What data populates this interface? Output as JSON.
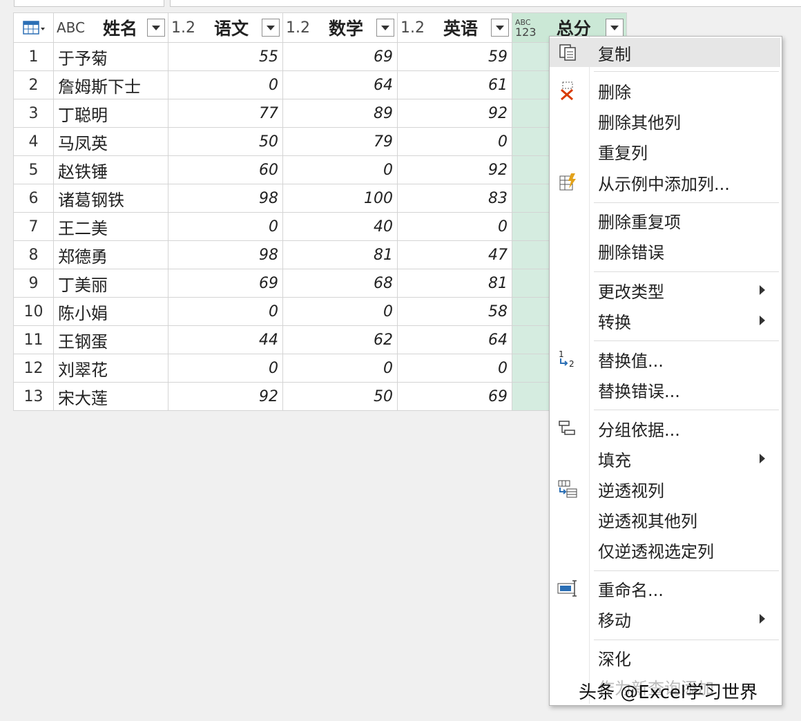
{
  "columns": [
    {
      "type": "ABC",
      "name": "姓名"
    },
    {
      "type": "1.2",
      "name": "语文"
    },
    {
      "type": "1.2",
      "name": "数学"
    },
    {
      "type": "1.2",
      "name": "英语"
    },
    {
      "type_top": "ABC",
      "type_bottom": "123",
      "name": "总分"
    }
  ],
  "rows": [
    {
      "n": "1",
      "name": "于予菊",
      "yw": "55",
      "sx": "69",
      "yy": "59"
    },
    {
      "n": "2",
      "name": "詹姆斯下士",
      "yw": "0",
      "sx": "64",
      "yy": "61"
    },
    {
      "n": "3",
      "name": "丁聪明",
      "yw": "77",
      "sx": "89",
      "yy": "92"
    },
    {
      "n": "4",
      "name": "马凤英",
      "yw": "50",
      "sx": "79",
      "yy": "0"
    },
    {
      "n": "5",
      "name": "赵铁锤",
      "yw": "60",
      "sx": "0",
      "yy": "92"
    },
    {
      "n": "6",
      "name": "诸葛钢铁",
      "yw": "98",
      "sx": "100",
      "yy": "83"
    },
    {
      "n": "7",
      "name": "王二美",
      "yw": "0",
      "sx": "40",
      "yy": "0"
    },
    {
      "n": "8",
      "name": "郑德勇",
      "yw": "98",
      "sx": "81",
      "yy": "47"
    },
    {
      "n": "9",
      "name": "丁美丽",
      "yw": "69",
      "sx": "68",
      "yy": "81"
    },
    {
      "n": "10",
      "name": "陈小娟",
      "yw": "0",
      "sx": "0",
      "yy": "58"
    },
    {
      "n": "11",
      "name": "王钢蛋",
      "yw": "44",
      "sx": "62",
      "yy": "64"
    },
    {
      "n": "12",
      "name": "刘翠花",
      "yw": "0",
      "sx": "0",
      "yy": "0"
    },
    {
      "n": "13",
      "name": "宋大莲",
      "yw": "92",
      "sx": "50",
      "yy": "69"
    }
  ],
  "menu": {
    "copy": "复制",
    "remove": "删除",
    "remove_other_columns": "删除其他列",
    "duplicate_column": "重复列",
    "add_column_from_examples": "从示例中添加列...",
    "remove_duplicates": "删除重复项",
    "remove_errors": "删除错误",
    "change_type": "更改类型",
    "transform": "转换",
    "replace_values": "替换值...",
    "replace_errors": "替换错误...",
    "group_by": "分组依据...",
    "fill": "填充",
    "unpivot_columns": "逆透视列",
    "unpivot_other_columns": "逆透视其他列",
    "unpivot_only_selected": "仅逆透视选定列",
    "rename": "重命名...",
    "move": "移动",
    "drill_down": "深化",
    "add_as_new_query": "作为新查询添加"
  },
  "watermark": "头条 @Excel学习世界"
}
